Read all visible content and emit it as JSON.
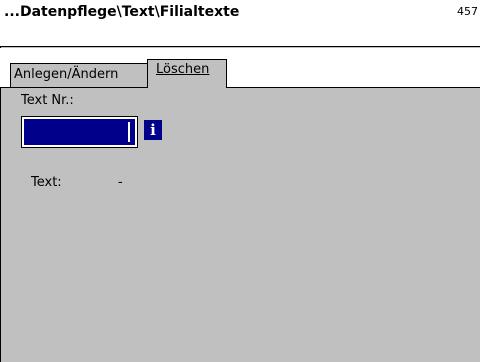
{
  "titlebar": {
    "title": "...Datenpflege\\Text\\Filialtexte",
    "code": "457"
  },
  "tabs": [
    {
      "label": "Anlegen/Ändern"
    },
    {
      "label": "Löschen"
    }
  ],
  "form": {
    "text_nr_label": "Text Nr.:",
    "text_nr_value": "",
    "info_button_glyph": "i",
    "text_label": "Text:",
    "text_value": "-"
  },
  "colors": {
    "panel_background": "#c0c0c0",
    "input_highlight": "#00008b",
    "title_background": "#ffffff"
  },
  "icons": {
    "info": "info-icon"
  }
}
